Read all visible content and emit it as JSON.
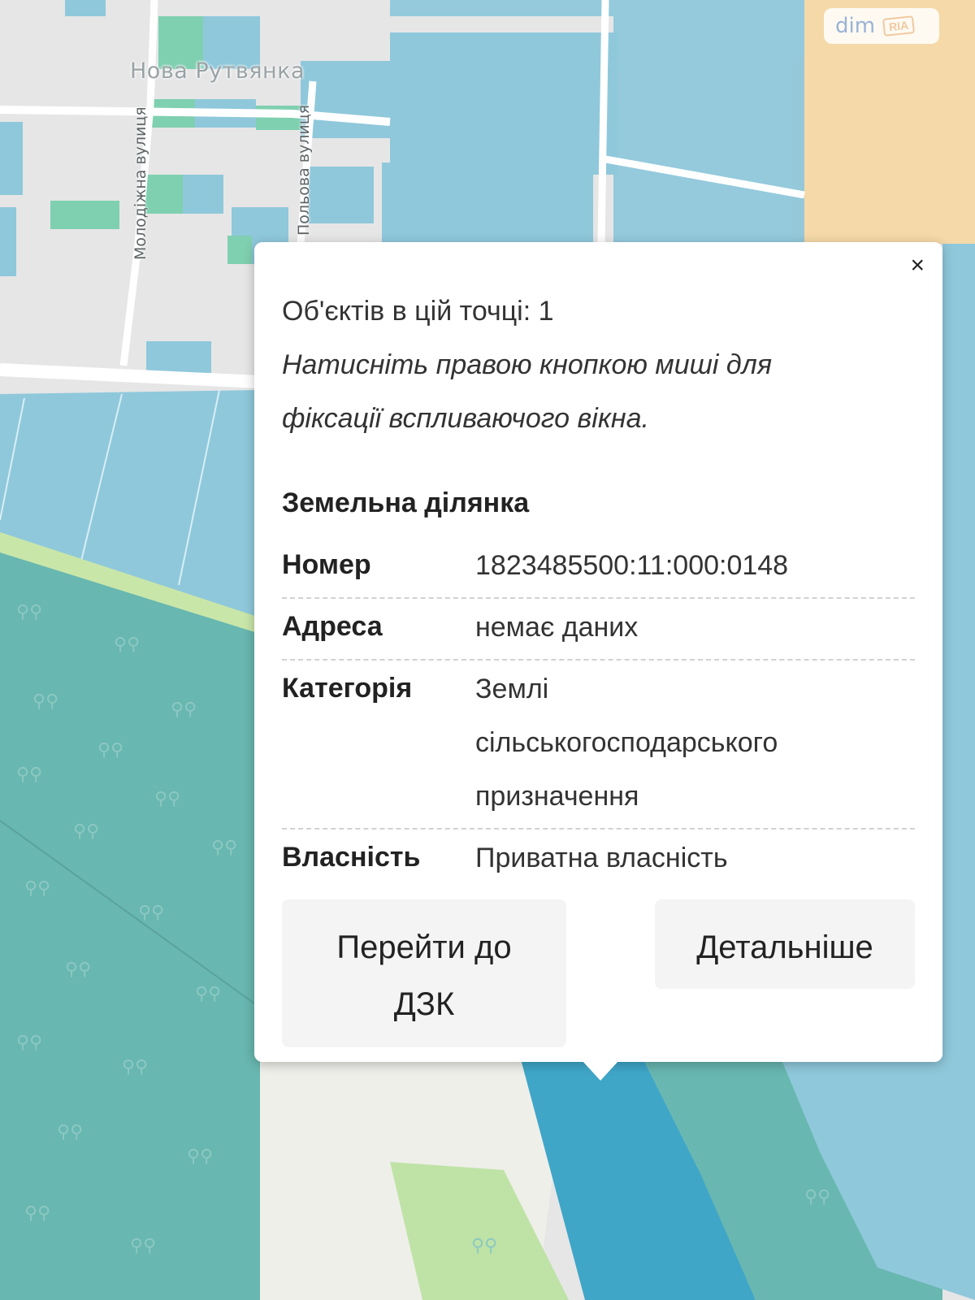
{
  "map": {
    "place_name": "Нова Рутвянка",
    "streets": [
      "Молодіжна вулиця",
      "Польова вулиця"
    ],
    "colors": {
      "residential": "#e6e6e6",
      "parcel_blue": "#8fc8db",
      "parcel_green": "#7fd0b0",
      "forest": "#68b7b0",
      "highlight_parcel": "#3fa6c8",
      "industrial": "#f5d9a8",
      "meadow": "#bfe3a6"
    }
  },
  "watermark": {
    "dim": "dim",
    "ria": "RIA"
  },
  "popup": {
    "close_icon": "×",
    "objects_count_text": "Об'єктів в цій точці: 1",
    "hint_line1": "Натисніть правою кнопкою миші для",
    "hint_line2": "фіксації вспливаючого вікна.",
    "section_title": "Земельна ділянка",
    "fields": [
      {
        "label": "Номер",
        "value": "1823485500:11:000:0148"
      },
      {
        "label": "Адреса",
        "value": "немає даних"
      },
      {
        "label": "Категорія",
        "value_lines": [
          "Землі",
          "сільськогосподарського",
          "призначення"
        ]
      },
      {
        "label": "Власність",
        "value": "Приватна власність"
      }
    ],
    "buttons": {
      "goto_dzk_line1": "Перейти до",
      "goto_dzk_line2": "ДЗК",
      "details": "Детальніше"
    }
  }
}
